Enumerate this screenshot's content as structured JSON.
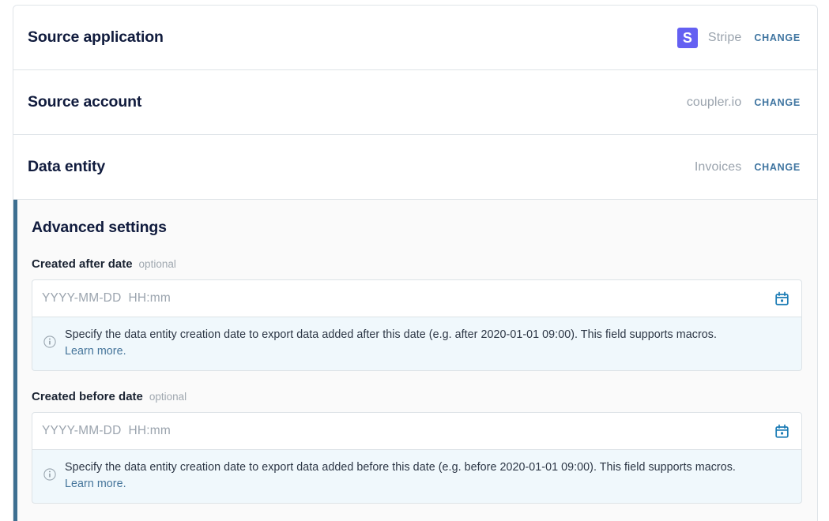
{
  "summary_rows": [
    {
      "title": "Source application",
      "value": "Stripe",
      "badge_letter": "S",
      "badge_color": "#6460f2",
      "change_label": "CHANGE",
      "name": "source-application"
    },
    {
      "title": "Source account",
      "value": "coupler.io",
      "change_label": "CHANGE",
      "name": "source-account"
    },
    {
      "title": "Data entity",
      "value": "Invoices",
      "change_label": "CHANGE",
      "name": "data-entity"
    }
  ],
  "advanced": {
    "title": "Advanced settings",
    "accent_color": "#3d6f91",
    "fields": [
      {
        "label": "Created after date",
        "optional_label": "optional",
        "value": "",
        "placeholder": "YYYY-MM-DD  HH:mm",
        "icon": "calendar-icon",
        "hint_icon": "info-circle-icon",
        "hint": "Specify the data entity creation date to export data added after this date (e.g. after 2020-01-01 09:00). This field supports macros.",
        "hint_link": "Learn more."
      },
      {
        "label": "Created before date",
        "optional_label": "optional",
        "value": "",
        "placeholder": "YYYY-MM-DD  HH:mm",
        "icon": "calendar-icon",
        "hint_icon": "info-circle-icon",
        "hint": "Specify the data entity creation date to export data added before this date (e.g. before 2020-01-01 09:00). This field supports macros.",
        "hint_link": "Learn more."
      }
    ]
  },
  "colors": {
    "accent_blue": "#3d6f91",
    "link_blue": "#44749a",
    "hint_bg": "#f0f8fc",
    "stripe_purple": "#6460f2",
    "title_navy": "#101b3d"
  }
}
